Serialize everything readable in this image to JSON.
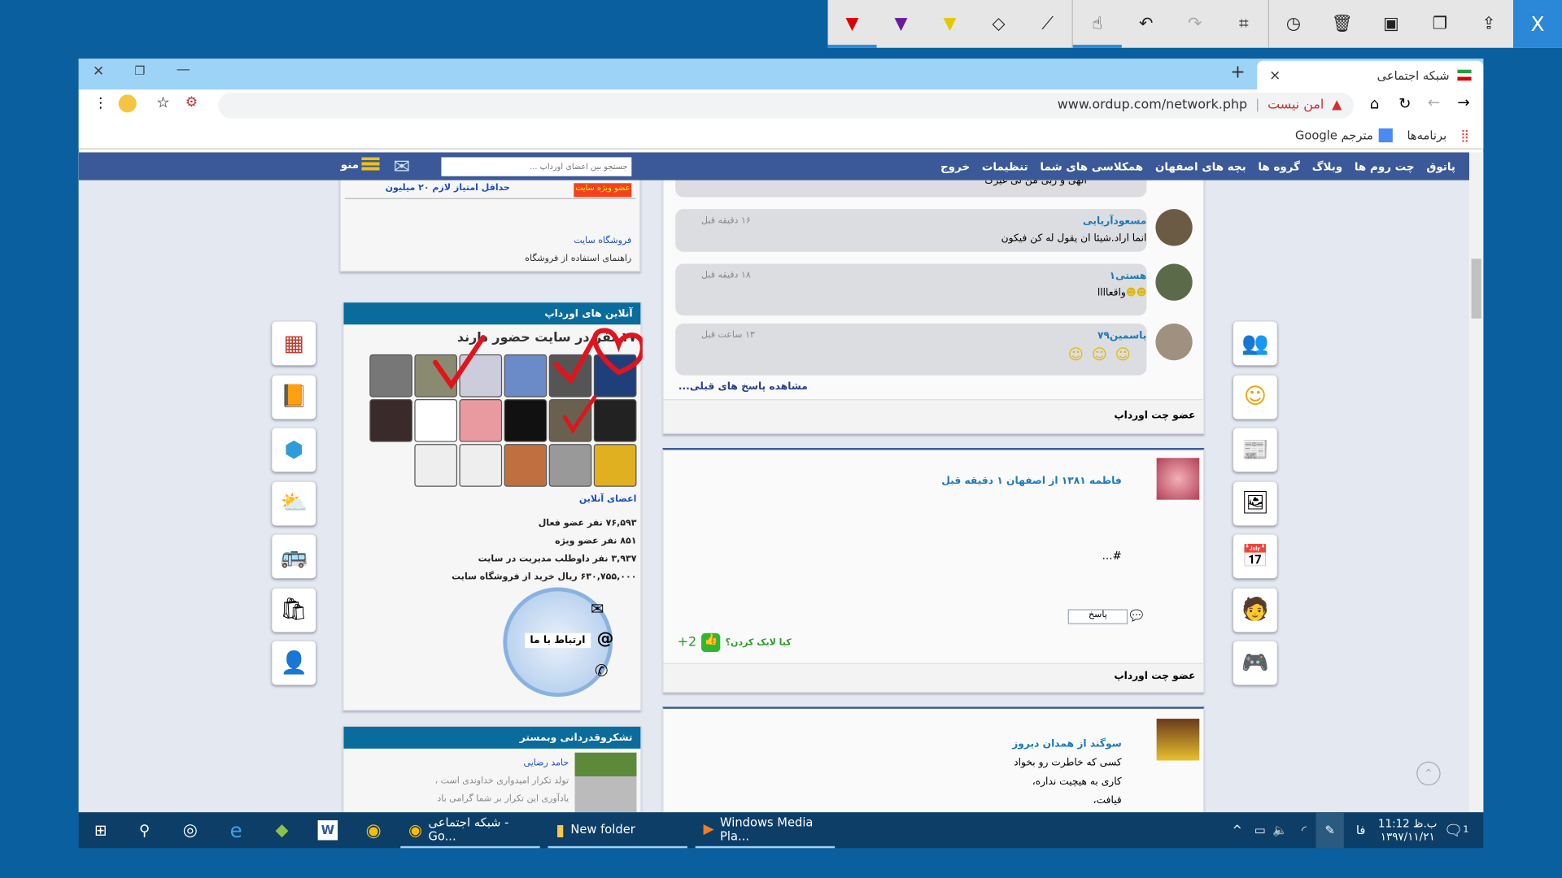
{
  "snip_toolbar": {
    "tools": [
      "red-pen-icon",
      "purple-pen-icon",
      "highlighter-icon",
      "eraser-icon",
      "ruler-icon",
      "touch-writing-icon",
      "undo-icon",
      "redo-icon",
      "crop-icon",
      "history-icon",
      "delete-icon",
      "save-icon",
      "copy-icon",
      "share-icon"
    ],
    "close": "X"
  },
  "browser": {
    "tab_title": "شبکه اجتماعی",
    "tab_close": "×",
    "new_tab": "+",
    "security_label": "امن نیست",
    "url": "www.ordup.com/network.php",
    "bookmarks": [
      "برنامه‌ها",
      "مترجم Google"
    ]
  },
  "nav": {
    "items": [
      "پاتوق",
      "چت روم ها",
      "وبلاگ",
      "گروه ها",
      "بچه های اصفهان",
      "همکلاسی های شما",
      "تنظیمات",
      "خروج"
    ],
    "search_placeholder": "جستجو بین اعضای اورداپ ...",
    "menu_label": "منو"
  },
  "shop": {
    "vip_badge": "عضو ویژه سایت",
    "min_points": "حداقل امتیاز لازم ۲۰ میلیون",
    "links": [
      "فروشگاه سایت",
      "راهنمای استفاده از فروشگاه"
    ]
  },
  "online": {
    "header": "آنلاین های اورداپ",
    "count_text": "۱۷ نفر در سایت حضور دارند",
    "members_link": "اعضای آنلاین",
    "stats": [
      "۷۶,۵۹۳ نفر عضو فعال",
      "۸۵۱ نفر عضو ویژه",
      "۳,۹۳۷ نفر داوطلب مدیریت در سایت",
      "۶۳۰,۷۵۵,۰۰۰ ریال خرید از فروشگاه سایت"
    ],
    "contact_label": "ارتباط با ما"
  },
  "thanks": {
    "header": "تشکروقدردانی وبمستر",
    "name": "حامد رضایی",
    "lines": [
      "تولد تکرار امیدواری خداوندی است ،",
      "یادآوری این تکرار بر شما گرامی باد"
    ]
  },
  "post1": {
    "comments": [
      {
        "name": "",
        "text": "الهی و ربی من لی غیرک",
        "time": ""
      },
      {
        "name": "مسعودآریایی",
        "text": "انما اراد.شیئا ان یقول له کن فیکون",
        "time": "۱۶ دقیقه قبل"
      },
      {
        "name": "هستی۱",
        "text": "واقعاااا",
        "time": "۱۸ دقیقه قبل"
      },
      {
        "name": "یاسمین۷۹",
        "text": "",
        "time": "۱۳ ساعت قبل"
      }
    ],
    "more": "مشاهده پاسخ های قبلی...",
    "footer": "عضو چت اورداپ"
  },
  "post2": {
    "header": "فاطمه ۱۳۸۱ از اصفهان ۱ دقیقه قبل",
    "body": "#...",
    "reply": "پاسخ",
    "likes": "+2",
    "who_liked": "کیا لایک کردن؟",
    "footer": "عضو چت اورداپ"
  },
  "post3": {
    "header": "سوگند از همدان دیروز",
    "lines": [
      "کسی که خاطرت رو بخواد",
      "کاری به هیچیت نداره،",
      "قیافت،"
    ]
  },
  "taskbar": {
    "apps": [
      {
        "label": "شبکه اجتماعی - Go..."
      },
      {
        "label": "New folder"
      },
      {
        "label": "Windows Media Pla..."
      }
    ],
    "lang": "فا",
    "time": "11:12 ب.ظ",
    "date": "۱۳۹۷/۱۱/۲۱",
    "notifications": "1"
  },
  "colors": {
    "nav": "#3b5998",
    "card_header": "#096c9c",
    "link": "#1d7ab8",
    "annotation": "#e0141c",
    "like": "#2eb82e"
  }
}
